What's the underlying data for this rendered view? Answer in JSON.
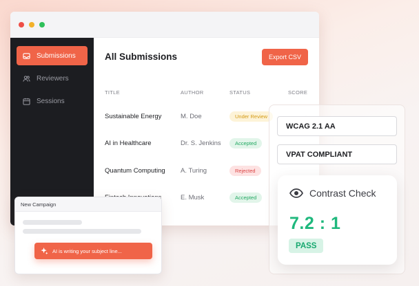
{
  "window": {
    "traffic_lights": [
      "#ee4e46",
      "#f3b12a",
      "#2fc05a"
    ]
  },
  "sidebar": {
    "items": [
      {
        "label": "Submissions",
        "icon": "inbox-icon",
        "active": true
      },
      {
        "label": "Reviewers",
        "icon": "users-icon",
        "active": false
      },
      {
        "label": "Sessions",
        "icon": "calendar-icon",
        "active": false
      }
    ]
  },
  "main": {
    "title": "All Submissions",
    "export_label": "Export CSV",
    "columns": [
      "TITLE",
      "AUTHOR",
      "STATUS",
      "SCORE"
    ],
    "rows": [
      {
        "title": "Sustainable Energy",
        "author": "M. Doe",
        "status": "Under Review",
        "score": "-"
      },
      {
        "title": "AI in Healthcare",
        "author": "Dr. S. Jenkins",
        "status": "Accepted",
        "score": ""
      },
      {
        "title": "Quantum Computing",
        "author": "A. Turing",
        "status": "Rejected",
        "score": ""
      },
      {
        "title": "Fintech Innovations",
        "author": "E. Musk",
        "status": "Accepted",
        "score": ""
      }
    ]
  },
  "compliance": {
    "badges": [
      "WCAG 2.1 AA",
      "VPAT COMPLIANT"
    ],
    "contrast": {
      "icon": "eye-icon",
      "title": "Contrast Check",
      "ratio": "7.2 : 1",
      "result": "PASS"
    }
  },
  "campaign": {
    "title": "New Campaign",
    "ai_icon": "sparkle-icon",
    "ai_status": "AI is writing your subject line..."
  },
  "colors": {
    "accent": "#f06448",
    "sidebar_bg": "#1c1d21",
    "success": "#1fb87d"
  }
}
